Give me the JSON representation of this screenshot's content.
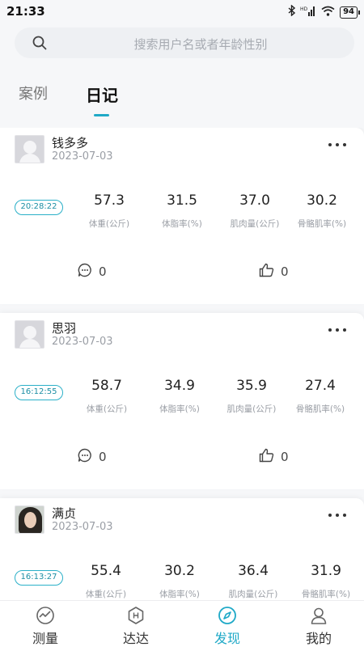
{
  "status_bar": {
    "time": "21:33",
    "battery": "94"
  },
  "search": {
    "placeholder": "搜索用户名或者年龄性别",
    "icon": "search-icon"
  },
  "tabs": [
    {
      "label": "案例",
      "active": false
    },
    {
      "label": "日记",
      "active": true
    }
  ],
  "metric_labels": [
    "体重(公斤)",
    "体脂率(%)",
    "肌肉量(公斤)",
    "骨骼肌率(%)"
  ],
  "posts": [
    {
      "name": "钱多多",
      "date": "2023-07-03",
      "avatar": "default-avatar",
      "time": "20:28:22",
      "metrics": [
        "57.3",
        "31.5",
        "37.0",
        "30.2"
      ],
      "comments": "0",
      "likes": "0"
    },
    {
      "name": "思羽",
      "date": "2023-07-03",
      "avatar": "default-avatar",
      "time": "16:12:55",
      "metrics": [
        "58.7",
        "34.9",
        "35.9",
        "27.4"
      ],
      "comments": "0",
      "likes": "0"
    },
    {
      "name": "满贞",
      "date": "2023-07-03",
      "avatar": "photo-avatar",
      "time": "16:13:27",
      "metrics": [
        "55.4",
        "30.2",
        "36.4",
        "31.9"
      ],
      "comments": "",
      "likes": ""
    }
  ],
  "bottom_nav": [
    {
      "label": "测量",
      "icon": "measure-icon",
      "active": false
    },
    {
      "label": "达达",
      "icon": "hexagon-icon",
      "active": false
    },
    {
      "label": "发现",
      "icon": "compass-icon",
      "active": true
    },
    {
      "label": "我的",
      "icon": "profile-icon",
      "active": false
    }
  ],
  "colors": {
    "accent": "#1fa9c7",
    "background": "#f6f7f9"
  }
}
